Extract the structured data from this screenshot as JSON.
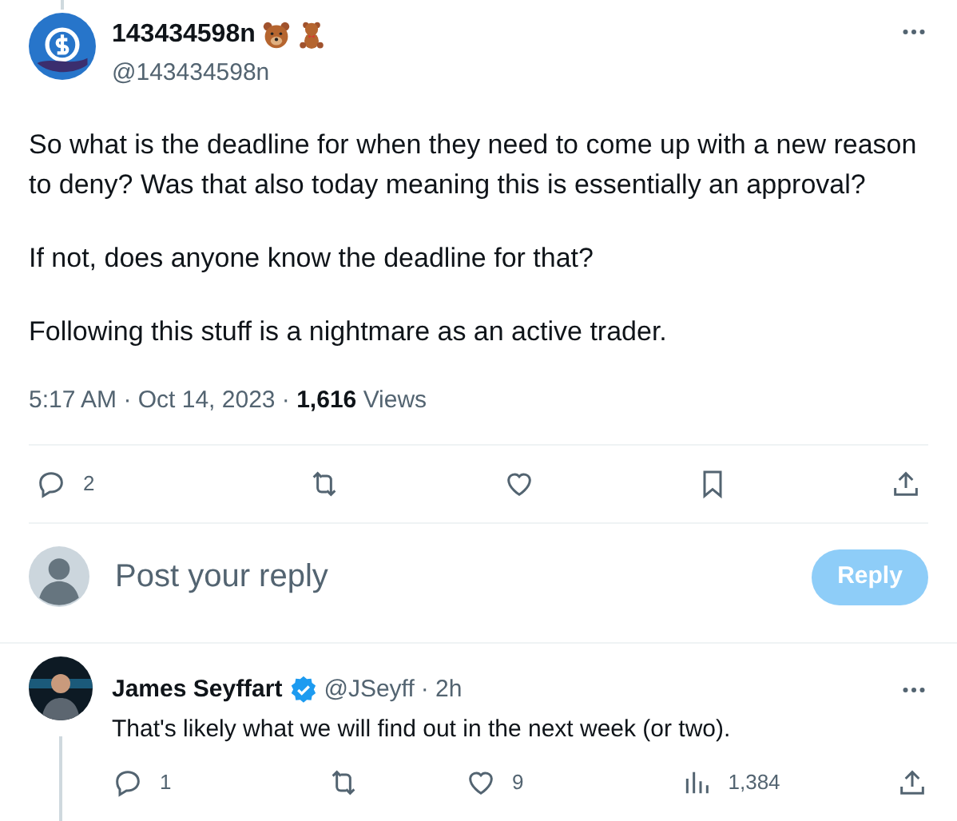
{
  "tweet": {
    "name": "143434598n",
    "handle": "@143434598n",
    "paragraphs": [
      "So what is the deadline for when they need to come up with a new reason to deny?  Was that also today meaning this is essentially an approval?",
      "If not, does anyone know the deadline for that?",
      "Following this stuff is a nightmare as an active trader."
    ],
    "time": "5:17 AM · Oct 14, 2023 · ",
    "views_count": "1,616",
    "views_label": "Views",
    "actions": [
      {
        "kind": "reply",
        "count": "2"
      },
      {
        "kind": "retweet"
      },
      {
        "kind": "like"
      },
      {
        "kind": "bookmark"
      },
      {
        "kind": "share"
      }
    ]
  },
  "composer": {
    "placeholder": "Post your reply",
    "button": "Reply",
    "disabled": true
  },
  "reply": {
    "name": "James Seyffart",
    "verified": true,
    "handle": "@JSeyff",
    "time": "· 2h",
    "text": "That's likely what we will find out in the next week (or two).",
    "actions": [
      {
        "kind": "reply",
        "count": "1"
      },
      {
        "kind": "retweet"
      },
      {
        "kind": "like",
        "count": "9"
      },
      {
        "kind": "views",
        "count": "1,384"
      },
      {
        "kind": "share"
      }
    ]
  }
}
